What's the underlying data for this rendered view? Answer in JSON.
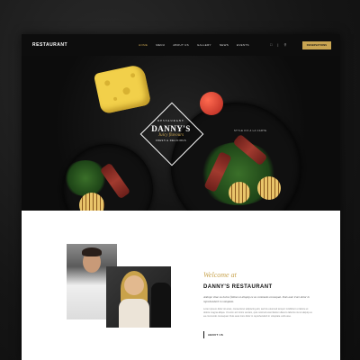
{
  "header": {
    "brand": "RESTAURANT",
    "nav": [
      "HOME",
      "MENU",
      "ABOUT US",
      "GALLERY",
      "NEWS",
      "EVENTS"
    ],
    "active_nav": "HOME",
    "cart_icon": "bag-icon",
    "search_icon": "search-icon",
    "reserve_label": "RESERVATIONS"
  },
  "hero": {
    "logo_line1": "RESTAURANT",
    "logo_name": "DANNY'S",
    "logo_tagline": "Juicy flavours",
    "logo_sub": "FRESH & DELICIOUS",
    "side_note": "STYLE FIX A LA CARTE"
  },
  "about": {
    "welcome": "Welcome at",
    "name": "DANNY'S RESTAURANT",
    "quote": "Antiope vitae ea luctus finibus ut aliquip ex ea commodo consequat. Duis aute irure dolor in reprehenderit in voluptate.",
    "body": "Lorem ipsum dolor sit amet, consectetur adipiscing elit, sed do eiusmod tempor incididunt ut labore et dolore magna aliqua. Ut enim ad minim veniam, quis nostrud exercitation ullamco laboris nisi ut aliquip ex ea commodo consequat. Duis aute irure dolor in reprehenderit in voluptate velit esse.",
    "button_label": "ABOUT US"
  },
  "colors": {
    "accent": "#c9a552",
    "dark": "#0d0d0d",
    "light": "#ffffff"
  }
}
